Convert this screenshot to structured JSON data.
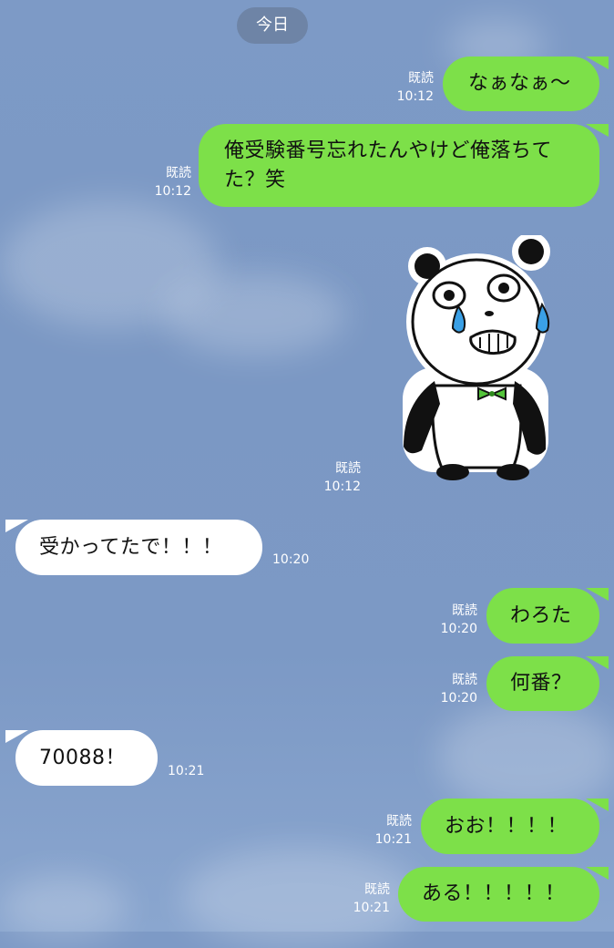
{
  "date_pill": "今日",
  "colors": {
    "sent_bubble": "#7de049",
    "received_bubble": "#ffffff",
    "background": "#7b98c4",
    "pill": "#6e84a6"
  },
  "messages": [
    {
      "side": "sent",
      "text": "なぁなぁ〜",
      "read": "既読",
      "time": "10:12"
    },
    {
      "side": "sent",
      "text": "俺受験番号忘れたんやけど俺落ちてた？笑",
      "read": "既読",
      "time": "10:12"
    },
    {
      "side": "sent",
      "type": "sticker",
      "sticker": "crying-panda-sticker",
      "read": "既読",
      "time": "10:12"
    },
    {
      "side": "received",
      "text": "受かってたで！！！",
      "time": "10:20"
    },
    {
      "side": "sent",
      "text": "わろた",
      "read": "既読",
      "time": "10:20"
    },
    {
      "side": "sent",
      "text": "何番？",
      "read": "既読",
      "time": "10:20"
    },
    {
      "side": "received",
      "text": "70088！",
      "time": "10:21"
    },
    {
      "side": "sent",
      "text": "おお！！！！",
      "read": "既読",
      "time": "10:21"
    },
    {
      "side": "sent",
      "text": "ある！！！！！",
      "read": "既読",
      "time": "10:21"
    }
  ]
}
